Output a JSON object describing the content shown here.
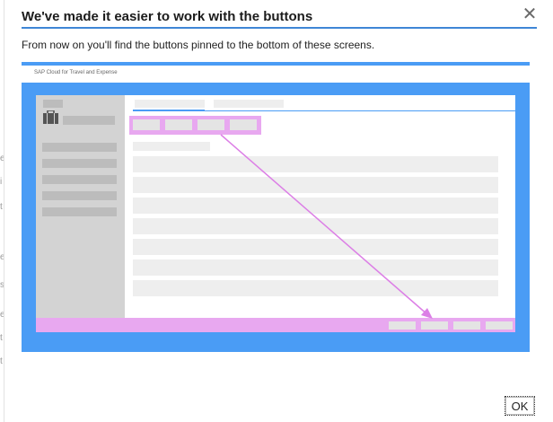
{
  "background": {
    "letters": [
      "e",
      "i",
      "t",
      "e",
      "s",
      "e",
      "t",
      "t"
    ]
  },
  "dialog": {
    "title": "We've made it easier to work with the buttons",
    "close_glyph": "✕",
    "message": "From now on you'll find the buttons pinned to the bottom of these screens.",
    "ok_label": "OK"
  },
  "illustration": {
    "brand_text": "SAP Cloud for Travel and Expense",
    "colors": {
      "frame": "#4a9cf5",
      "highlight": "#e8a8f0",
      "arrow": "#dc7fe6"
    },
    "icon": "briefcase-icon"
  }
}
